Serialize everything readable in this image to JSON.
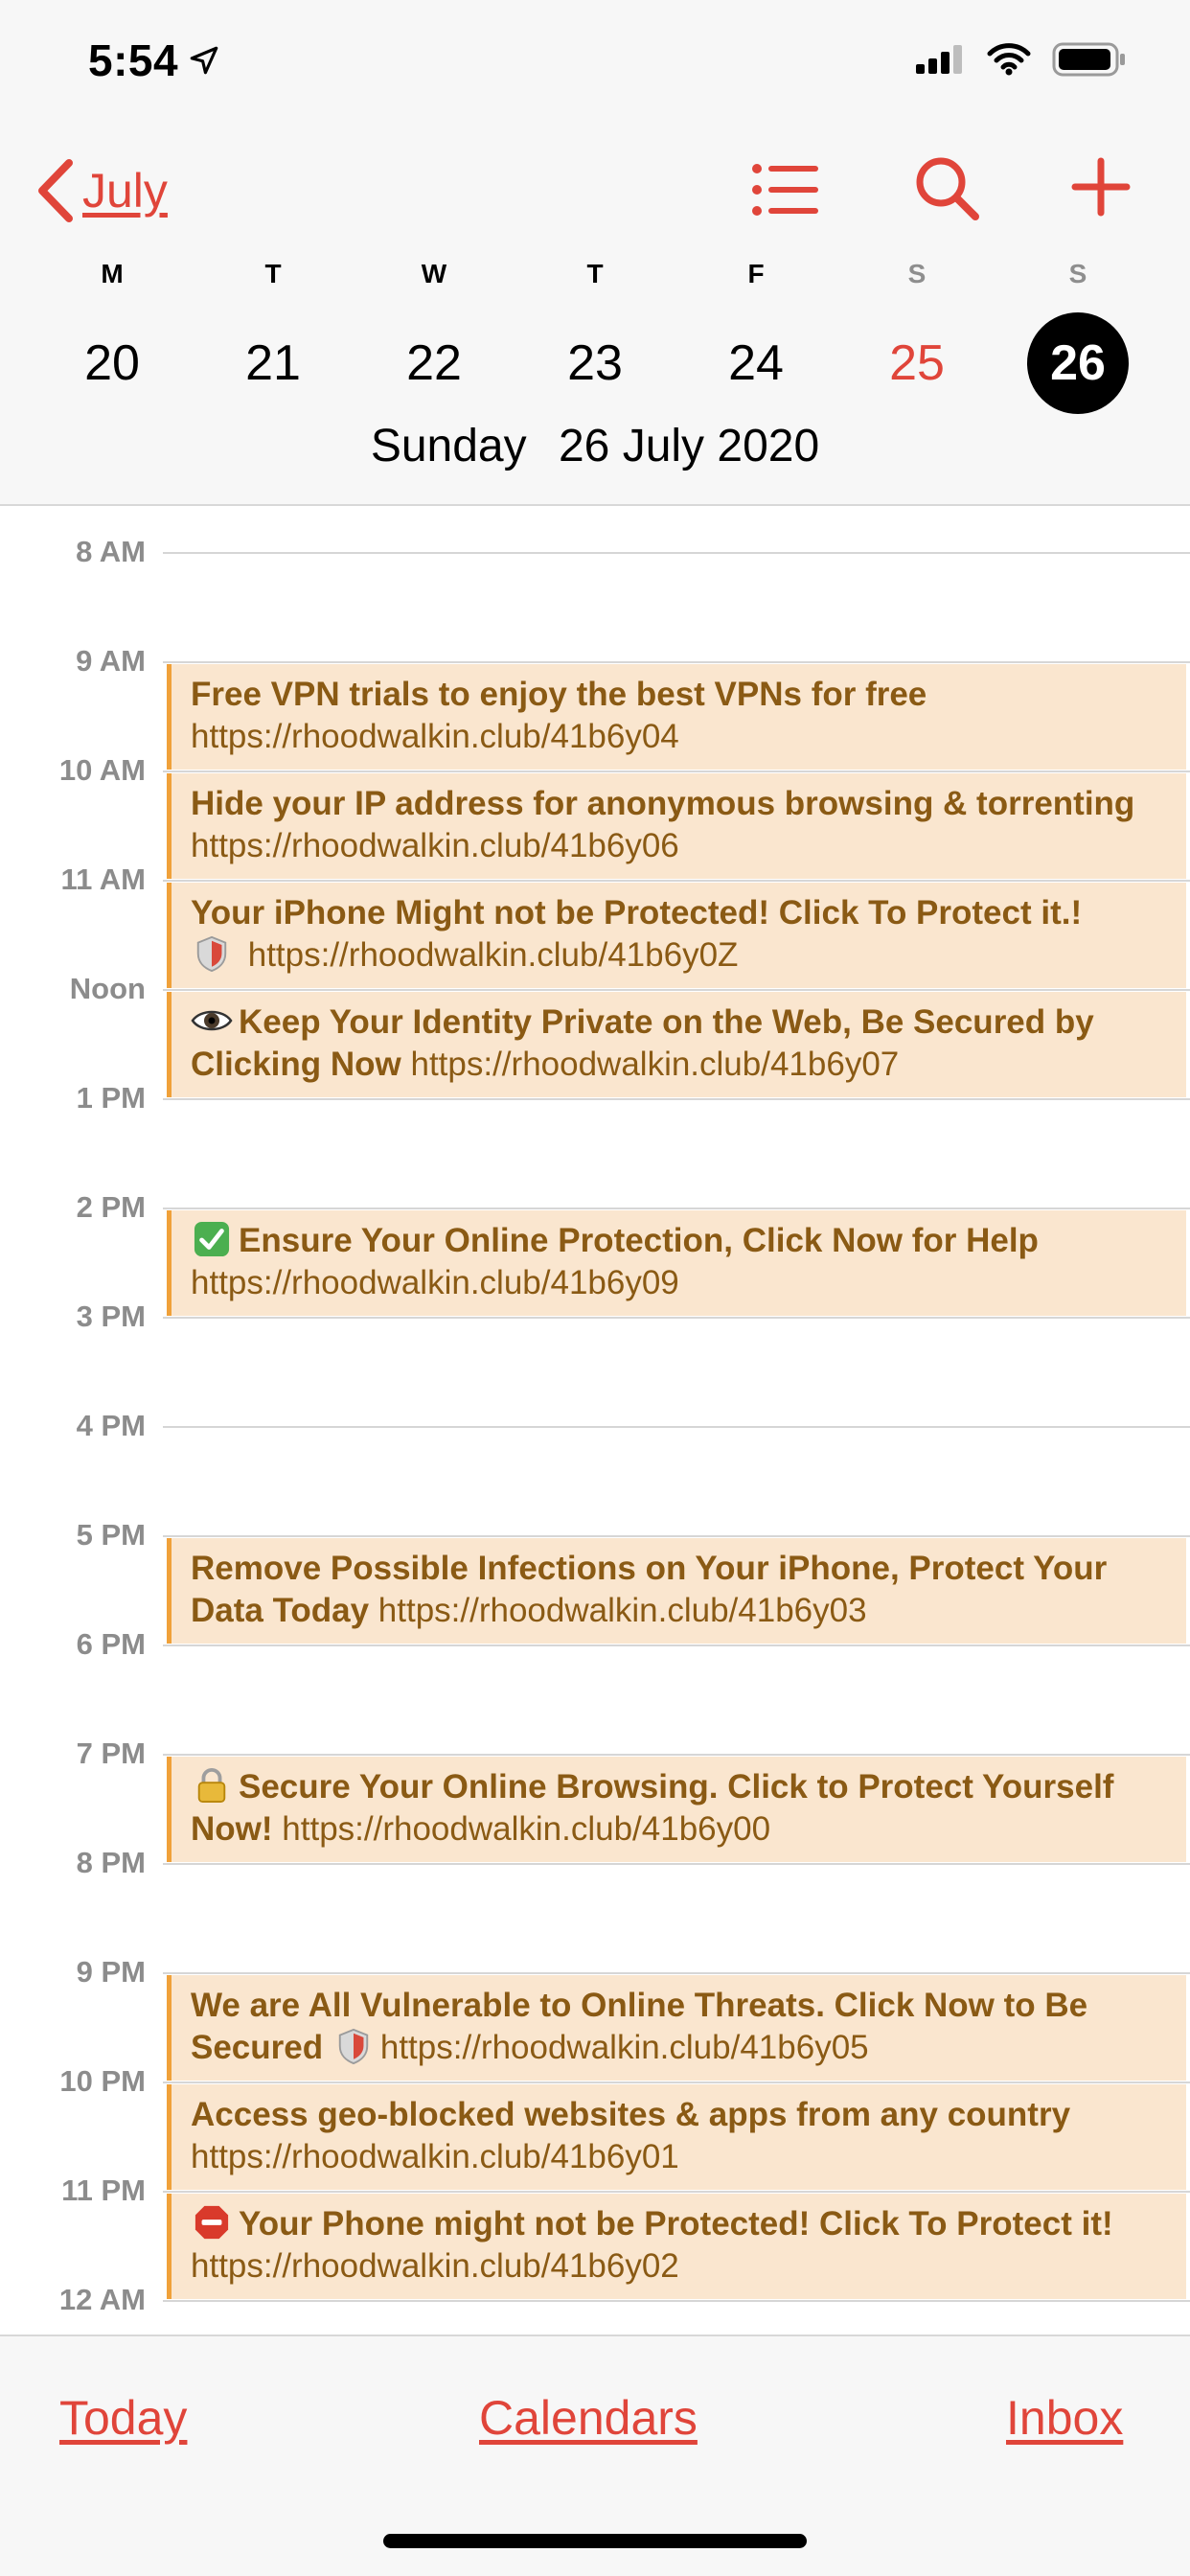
{
  "status_bar": {
    "time": "5:54",
    "icons": [
      "location-arrow-icon",
      "cellular-signal-icon",
      "wifi-icon",
      "battery-icon"
    ]
  },
  "nav": {
    "back_label": "July",
    "icons": [
      "list-icon",
      "search-icon",
      "add-icon"
    ],
    "accent_color": "#e0453a"
  },
  "week": {
    "letters": [
      "M",
      "T",
      "W",
      "T",
      "F",
      "S",
      "S"
    ],
    "days": [
      "20",
      "21",
      "22",
      "23",
      "24",
      "25",
      "26"
    ],
    "selected": "26"
  },
  "day_title": {
    "weekday": "Sunday",
    "date": "26 July 2020"
  },
  "hours": [
    "8 AM",
    "9 AM",
    "10 AM",
    "11 AM",
    "Noon",
    "1 PM",
    "2 PM",
    "3 PM",
    "4 PM",
    "5 PM",
    "6 PM",
    "7 PM",
    "8 PM",
    "9 PM",
    "10 PM",
    "11 PM",
    "12 AM"
  ],
  "events": [
    {
      "title": "Free VPN trials to enjoy the best VPNs for free",
      "url": "https://rhoodwalkin.club/41b6y04"
    },
    {
      "title": "Hide your IP address for anonymous browsing & torrenting",
      "url": "https://rhoodwalkin.club/41b6y06"
    },
    {
      "title": "Your iPhone Might not be Protected! Click To Protect it.!",
      "icon": "shield-icon",
      "url": "https://rhoodwalkin.club/41b6y0Z"
    },
    {
      "icon": "eye-icon",
      "title": "Keep Your Identity Private on the Web, Be Secured by Clicking Now",
      "url": "https://rhoodwalkin.club/41b6y07"
    },
    {
      "icon": "check-mark-icon",
      "title": "Ensure Your Online Protection, Click Now for Help",
      "url": "https://rhoodwalkin.club/41b6y09"
    },
    {
      "title": "Remove Possible Infections on Your iPhone, Protect Your Data Today",
      "url": "https://rhoodwalkin.club/41b6y03"
    },
    {
      "icon": "lock-icon",
      "title": "Secure Your Online Browsing. Click to Protect Yourself Now!",
      "url": "https://rhoodwalkin.club/41b6y00"
    },
    {
      "title": "We are All Vulnerable to Online Threats. Click Now to Be Secured",
      "icon": "shield-icon",
      "url": "https://rhoodwalkin.club/41b6y05"
    },
    {
      "title": "Access geo-blocked websites & apps from any country",
      "url": "https://rhoodwalkin.club/41b6y01"
    },
    {
      "icon": "stop-sign-icon",
      "title": "Your Phone might not be Protected! Click To Protect it!",
      "url": "https://rhoodwalkin.club/41b6y02"
    }
  ],
  "bottom_bar": {
    "today": "Today",
    "calendars": "Calendars",
    "inbox": "Inbox"
  },
  "event_colors": {
    "background": "#fae6cf",
    "border": "#f0a13a",
    "text": "#8a5a14"
  }
}
